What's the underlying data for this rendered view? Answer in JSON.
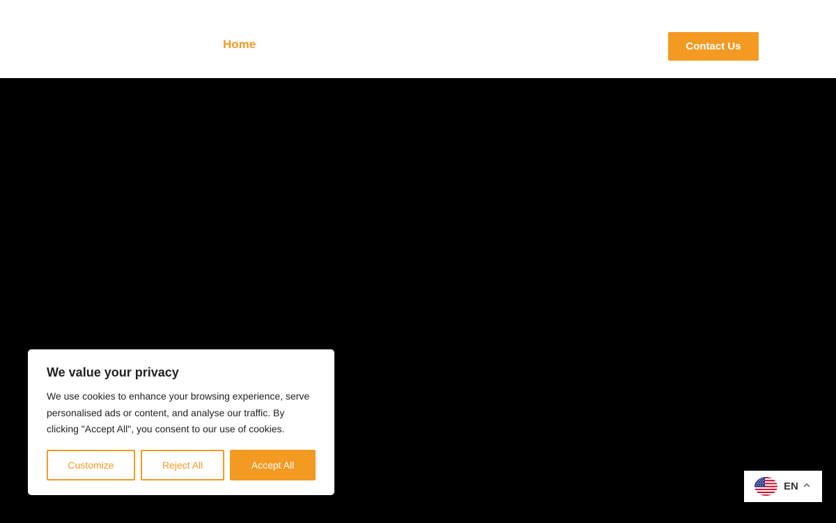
{
  "colors": {
    "accent": "#f39a22",
    "header_bg": "#ffffff",
    "hero_bg": "#000000",
    "text_dark": "#212121"
  },
  "header": {
    "nav": {
      "home_label": "Home"
    },
    "contact_button_label": "Contact Us"
  },
  "cookie_banner": {
    "title": "We value your privacy",
    "text": "We use cookies to enhance your browsing experience, serve personalised ads or content, and analyse our traffic. By clicking \"Accept All\", you consent to our use of cookies.",
    "buttons": {
      "customize": "Customize",
      "reject": "Reject All",
      "accept": "Accept All"
    }
  },
  "language_switcher": {
    "code": "EN",
    "flag_icon": "us-flag-icon",
    "chevron_icon": "chevron-up-icon"
  }
}
